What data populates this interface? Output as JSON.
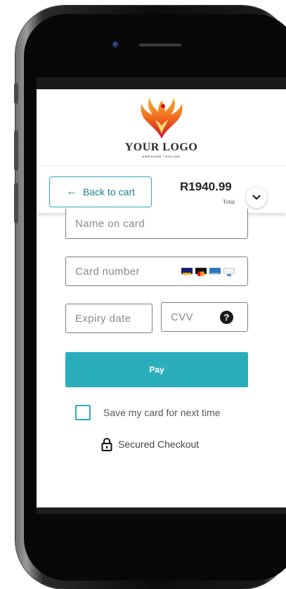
{
  "brand": {
    "logo_text": "YOUR LOGO",
    "tagline": "AWESOME TAGLINE"
  },
  "cart_bar": {
    "back_label": "Back to cart",
    "back_icon": "arrow-left-icon",
    "total_amount": "R1940.99",
    "total_label": "Total",
    "expand_icon": "chevron-down-icon"
  },
  "form": {
    "name_placeholder": "Name on card",
    "card_number_placeholder": "Card number",
    "card_brand_icons": [
      "visa-icon",
      "mastercard-icon",
      "amex-icon",
      "generic-card-icon"
    ],
    "expiry_placeholder": "Expiry date",
    "cvv_placeholder": "CVV",
    "cvv_help_icon": "question-circle-icon",
    "pay_label": "Pay",
    "save_card_label": "Save my card for next time",
    "save_card_checked": false,
    "secured_label": "Secured Checkout",
    "secured_icon": "lock-icon"
  },
  "colors": {
    "accent": "#2aaebb",
    "accent_text": "#1f7f88",
    "text_dark": "#222222",
    "placeholder": "#8a8a8a"
  }
}
